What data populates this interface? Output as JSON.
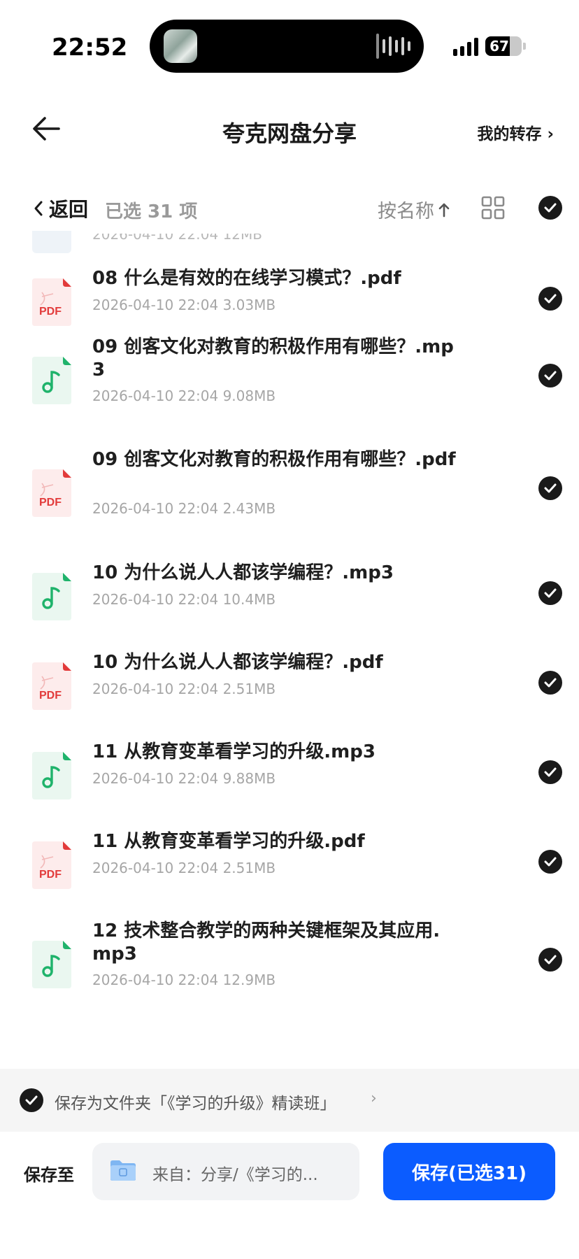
{
  "status_bar": {
    "time": "22:52",
    "battery": "67",
    "battery_level": 0.67
  },
  "header": {
    "title": "夸克网盘分享",
    "my_transfer": "我的转存 ›"
  },
  "toolbar": {
    "back": "返回",
    "selected": "已选 31 项",
    "sort": "按名称"
  },
  "list": {
    "partial_meta": "2026-04-10 22:04  12MB",
    "items": [
      {
        "type": "pdf",
        "name": "08 什么是有效的在线学习模式？.pdf",
        "meta": "2026-04-10 22:04  3.03MB"
      },
      {
        "type": "mp3",
        "name": "09 创客文化对教育的积极作用有哪些？.mp3",
        "meta": "2026-04-10 22:04  9.08MB"
      },
      {
        "type": "pdf",
        "name": "09 创客文化对教育的积极作用有哪些？.pdf",
        "meta": "2026-04-10 22:04  2.43MB"
      },
      {
        "type": "mp3",
        "name": "10 为什么说人人都该学编程？.mp3",
        "meta": "2026-04-10 22:04  10.4MB"
      },
      {
        "type": "pdf",
        "name": "10 为什么说人人都该学编程？.pdf",
        "meta": "2026-04-10 22:04  2.51MB"
      },
      {
        "type": "mp3",
        "name": "11 从教育变革看学习的升级.mp3",
        "meta": "2026-04-10 22:04  9.88MB"
      },
      {
        "type": "pdf",
        "name": "11 从教育变革看学习的升级.pdf",
        "meta": "2026-04-10 22:04  2.51MB"
      },
      {
        "type": "mp3",
        "name": "12 技术整合教学的两种关键框架及其应用.mp3",
        "meta": "2026-04-10 22:04  12.9MB"
      }
    ],
    "pdf_label": "PDF"
  },
  "save_folder": {
    "text": "保存为文件夹「《学习的升级》精读班」"
  },
  "bottom": {
    "save_to": "保存至",
    "destination": "来自：分享/《学习的...",
    "save_button": "保存(已选31)"
  },
  "colors": {
    "accent": "#0b5cff",
    "pdf_red": "#e23b3b",
    "audio_green": "#1fb36b"
  }
}
